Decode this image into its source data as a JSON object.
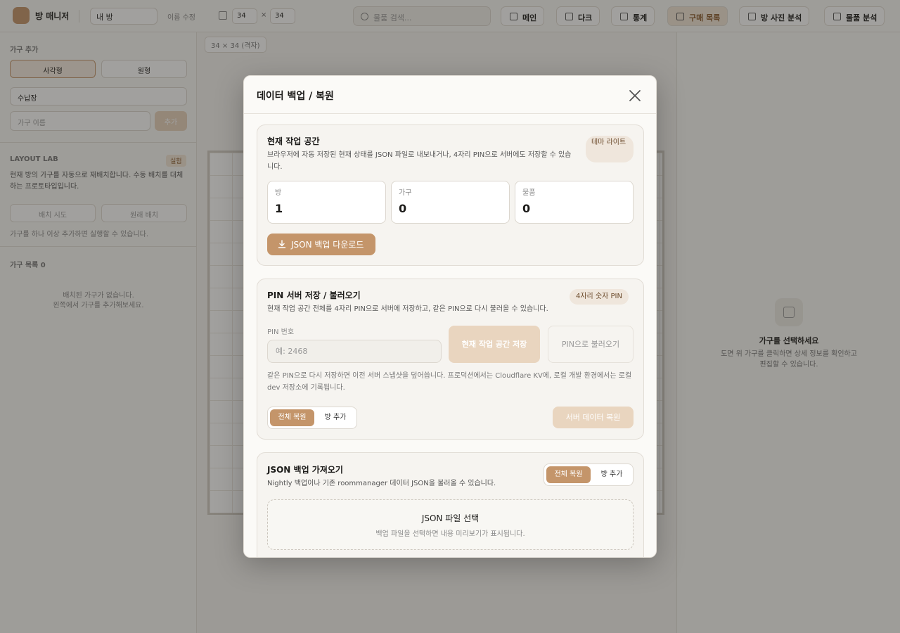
{
  "app": {
    "logo_text": "방 매니저",
    "room_select": "내 방",
    "rename_label": "이름 수정",
    "room_width": "34",
    "room_x": "×",
    "room_height": "34",
    "search_placeholder": "물품 검색...",
    "toolbar": [
      "메인",
      "다크",
      "통계",
      "구매 목록",
      "방 사진 분석",
      "물품 분석"
    ],
    "sidebar": {
      "furniture_heading": "가구 추가",
      "mode_rect": "사각형",
      "mode_circle": "원형",
      "category": "수납장",
      "name_placeholder": "가구 이름",
      "add_button": "추가",
      "lab_heading": "LAYOUT LAB",
      "lab_badge": "실험",
      "lab_desc": "현재 방의 가구를 자동으로 재배치합니다. 수동 배치를 대체하는 프로토타입입니다.",
      "lab_run": "배치 시도",
      "lab_reset": "원래 배치",
      "lab_note": "가구를 하나 이상 추가하면 실행할 수 있습니다.",
      "list_heading": "가구 목록 0",
      "empty_line1": "배치된 가구가 없습니다.",
      "empty_line2": "왼쪽에서 가구를 추가해보세요."
    },
    "canvas_tag": "34 × 34 (격자)",
    "right_panel": {
      "title": "가구를 선택하세요",
      "desc": "도면 위 가구를 클릭하면 상세 정보를 확인하고 편집할 수 있습니다."
    }
  },
  "modal": {
    "title": "데이터 백업 / 복원",
    "workspace": {
      "title": "현재 작업 공간",
      "desc": "브라우저에 자동 저장된 현재 상태를 JSON 파일로 내보내거나, 4자리 PIN으로 서버에도 저장할 수 있습니다.",
      "theme_pill": "테마 라이트",
      "stats": [
        {
          "label": "방",
          "value": "1"
        },
        {
          "label": "가구",
          "value": "0"
        },
        {
          "label": "물품",
          "value": "0"
        }
      ],
      "download_button": "JSON 백업 다운로드"
    },
    "pin": {
      "title": "PIN 서버 저장 / 불러오기",
      "desc": "현재 작업 공간 전체를 4자리 PIN으로 서버에 저장하고, 같은 PIN으로 다시 불러올 수 있습니다.",
      "pill": "4자리 숫자 PIN",
      "field_label": "PIN 번호",
      "placeholder": "예: 2468",
      "save_button": "현재 작업 공간 저장",
      "load_button": "PIN으로 불러오기",
      "note": "같은 PIN으로 다시 저장하면 이전 서버 스냅샷을 덮어씁니다. 프로덕션에서는 Cloudflare KV에, 로컬 개발 환경에서는 로컬 dev 저장소에 기록됩니다.",
      "mode_full": "전체 복원",
      "mode_add": "방 추가",
      "restore_button": "서버 데이터 복원"
    },
    "json_import": {
      "title": "JSON 백업 가져오기",
      "desc": "Nightly 백업이나 기존 roommanager 데이터 JSON을 불러올 수 있습니다.",
      "mode_full": "전체 복원",
      "mode_add": "방 추가",
      "drop_title": "JSON 파일 선택",
      "drop_desc": "백업 파일을 선택하면 내용 미리보기가 표시됩니다."
    }
  }
}
